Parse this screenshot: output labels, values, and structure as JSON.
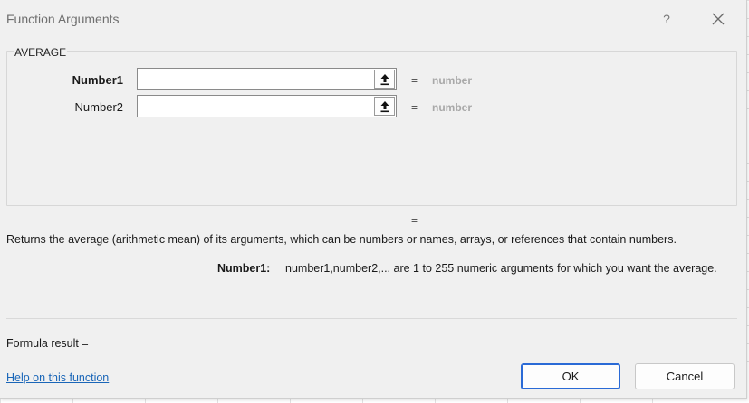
{
  "dialog": {
    "title": "Function Arguments",
    "help_glyph": "?",
    "close_glyph": "✕"
  },
  "function": {
    "name": "AVERAGE",
    "args": [
      {
        "label": "Number1",
        "value": "",
        "equals": "=",
        "type": "number"
      },
      {
        "label": "Number2",
        "value": "",
        "equals": "=",
        "type": "number"
      }
    ],
    "result_equals": "=",
    "description": "Returns the average (arithmetic mean) of its arguments, which can be numbers or names, arrays, or references that contain numbers.",
    "current_arg_name": "Number1:",
    "current_arg_description": "number1,number2,... are 1 to 255 numeric arguments for which you want the average."
  },
  "footer": {
    "formula_result": "Formula result =",
    "help_link": "Help on this function",
    "ok_label": "OK",
    "cancel_label": "Cancel"
  },
  "colors": {
    "accent": "#2a6ad6",
    "link": "#1a66b8",
    "dialog_bg": "#f0f0f0",
    "type_hint": "#a8a8a8"
  }
}
